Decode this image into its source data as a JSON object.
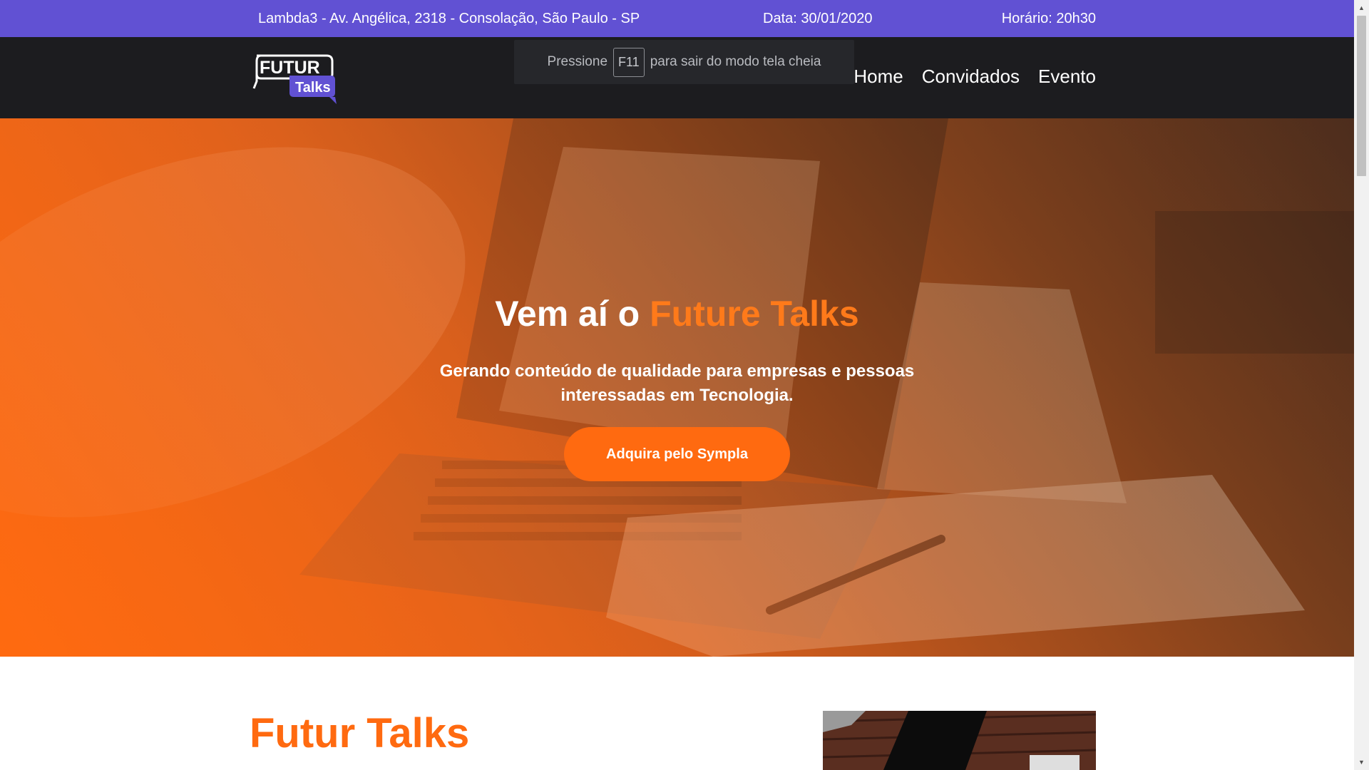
{
  "topbar": {
    "address": "Lambda3 - Av. Angélica, 2318 - Consolação, São Paulo - SP",
    "date": "Data: 30/01/2020",
    "time": "Horário: 20h30",
    "background": "#6151d3"
  },
  "logo": {
    "line1": "FUTUR",
    "line2": "Talks"
  },
  "fullscreen_notice": {
    "before": "Pressione",
    "key": "F11",
    "after": "para sair do modo tela cheia"
  },
  "nav": {
    "items": [
      {
        "label": "Home"
      },
      {
        "label": "Convidados"
      },
      {
        "label": "Evento"
      }
    ]
  },
  "hero": {
    "title_prefix": "Vem aí o",
    "title_accent": "Future Talks",
    "subtitle": "Gerando conteúdo de qualidade para empresas e pessoas interessadas em Tecnologia.",
    "cta_label": "Adquira pelo Sympla"
  },
  "section": {
    "title": "Futur Talks"
  },
  "colors": {
    "accent": "#ff6a10",
    "purple": "#6151d3",
    "nav_bg": "#1c1c1f"
  }
}
